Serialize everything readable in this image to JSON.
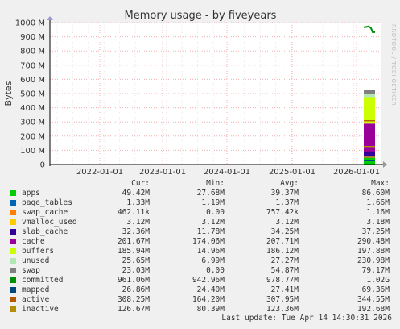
{
  "title": "Memory usage - by fiveyears",
  "side_label": "RRDTOOL / TOBI OETIKER",
  "ylabel": "Bytes",
  "chart_data": {
    "type": "area",
    "title": "Memory usage - by fiveyears",
    "ylabel": "Bytes",
    "ylim": [
      0,
      1000000000
    ],
    "yticks": [
      "0",
      "100 M",
      "200 M",
      "300 M",
      "400 M",
      "500 M",
      "600 M",
      "700 M",
      "800 M",
      "900 M",
      "1000 M"
    ],
    "xticks": [
      "2022-01-01",
      "2023-01-01",
      "2024-01-01",
      "2025-01-01",
      "2026-01-01"
    ],
    "grid": true,
    "stack_values_bytes": {
      "apps": 49420000,
      "page_tables": 1330000,
      "swap_cache": 462110,
      "vmalloc_used": 3120000,
      "slab_cache": 32360000,
      "cache": 201670000,
      "buffers": 185940000,
      "unused": 25650000,
      "swap": 23030000
    },
    "line_values_bytes": {
      "committed": 961060000,
      "mapped": 26860000,
      "active": 308250000,
      "inactive": 126670000
    }
  },
  "legend": {
    "headers": {
      "cur": "Cur:",
      "min": "Min:",
      "avg": "Avg:",
      "max": "Max:"
    },
    "rows": [
      {
        "name": "apps",
        "color": "#00cc00",
        "cur": "49.42M",
        "min": "27.68M",
        "avg": "39.37M",
        "max": "86.60M"
      },
      {
        "name": "page_tables",
        "color": "#0066b3",
        "cur": "1.33M",
        "min": "1.19M",
        "avg": "1.37M",
        "max": "1.66M"
      },
      {
        "name": "swap_cache",
        "color": "#ff8000",
        "cur": "462.11k",
        "min": "0.00",
        "avg": "757.42k",
        "max": "1.16M"
      },
      {
        "name": "vmalloc_used",
        "color": "#ffcc00",
        "cur": "3.12M",
        "min": "3.12M",
        "avg": "3.12M",
        "max": "3.18M"
      },
      {
        "name": "slab_cache",
        "color": "#330099",
        "cur": "32.36M",
        "min": "11.78M",
        "avg": "34.25M",
        "max": "37.25M"
      },
      {
        "name": "cache",
        "color": "#990099",
        "cur": "201.67M",
        "min": "174.06M",
        "avg": "207.71M",
        "max": "290.48M"
      },
      {
        "name": "buffers",
        "color": "#ccff00",
        "cur": "185.94M",
        "min": "14.96M",
        "avg": "186.12M",
        "max": "197.88M"
      },
      {
        "name": "unused",
        "color": "#b3e6b3",
        "cur": "25.65M",
        "min": "6.99M",
        "avg": "27.27M",
        "max": "230.98M"
      },
      {
        "name": "swap",
        "color": "#808080",
        "cur": "23.03M",
        "min": "0.00",
        "avg": "54.87M",
        "max": "79.17M"
      },
      {
        "name": "committed",
        "color": "#008f00",
        "cur": "961.06M",
        "min": "942.96M",
        "avg": "978.77M",
        "max": "1.02G"
      },
      {
        "name": "mapped",
        "color": "#00487d",
        "cur": "26.86M",
        "min": "24.40M",
        "avg": "27.41M",
        "max": "69.36M"
      },
      {
        "name": "active",
        "color": "#b35a00",
        "cur": "308.25M",
        "min": "164.20M",
        "avg": "307.95M",
        "max": "344.55M"
      },
      {
        "name": "inactive",
        "color": "#b38f00",
        "cur": "126.67M",
        "min": "80.39M",
        "avg": "123.36M",
        "max": "192.68M"
      }
    ]
  },
  "footer": "Last update: Tue Apr 14 14:30:31 2026"
}
